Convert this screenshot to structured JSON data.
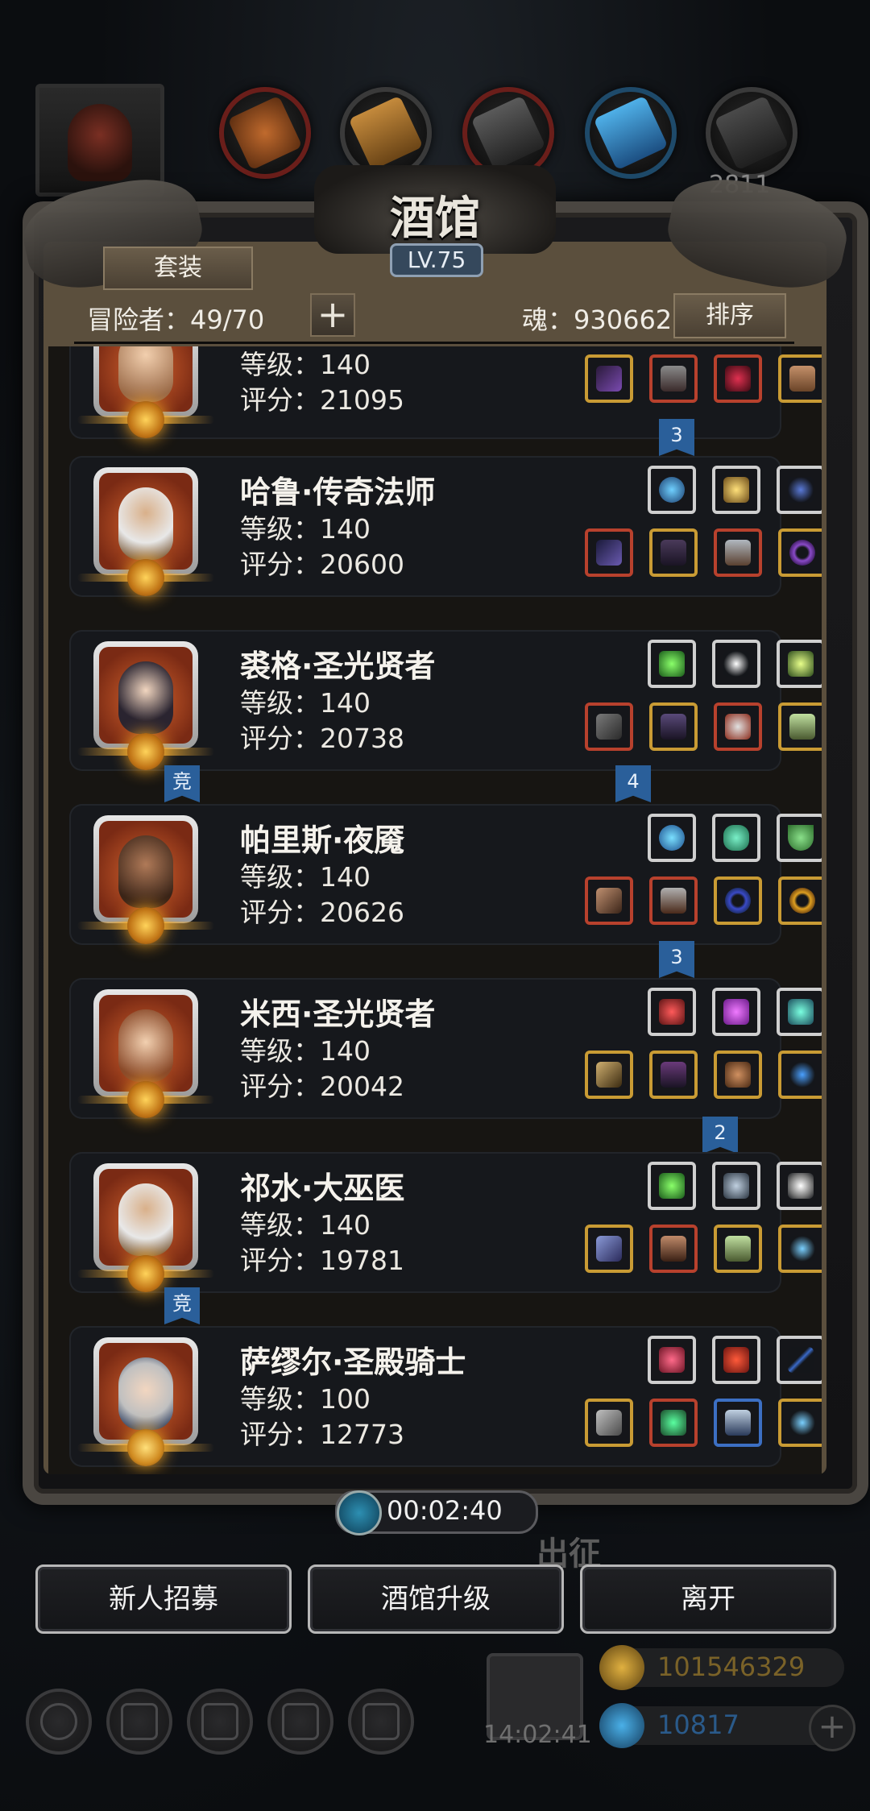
{
  "window": {
    "title": "酒馆",
    "level": "LV.75",
    "corner_number": "2811"
  },
  "toolbar": {
    "set_label": "套装",
    "adventurers_label": "冒险者：49/70",
    "add_label": "+",
    "soul_label": "魂：930662",
    "sort_label": "排序"
  },
  "heroes": [
    {
      "name": "",
      "level": "等级：140",
      "score": "评分：21095",
      "badge": "3"
    },
    {
      "name": "哈鲁·传奇法师",
      "level": "等级：140",
      "score": "评分：20600",
      "badge": ""
    },
    {
      "name": "裘格·圣光贤者",
      "level": "等级：140",
      "score": "评分：20738",
      "badge_left": "竞",
      "badge": "4"
    },
    {
      "name": "帕里斯·夜魇",
      "level": "等级：140",
      "score": "评分：20626",
      "badge": "3"
    },
    {
      "name": "米西·圣光贤者",
      "level": "等级：140",
      "score": "评分：20042",
      "badge": "2"
    },
    {
      "name": "祁水·大巫医",
      "level": "等级：140",
      "score": "评分：19781",
      "badge_left": "竞"
    },
    {
      "name": "萨缪尔·圣殿骑士",
      "level": "等级：100",
      "score": "评分：12773"
    }
  ],
  "timer": {
    "value": "00:02:40",
    "depart_label": "出征"
  },
  "buttons": {
    "recruit": "新人招募",
    "upgrade": "酒馆升级",
    "leave": "离开"
  },
  "bottom": {
    "gift_time": "14:02:41",
    "gold": "101546329",
    "gems": "10817",
    "plus": "+"
  },
  "colors": {
    "red_rarity": "#b8412d",
    "gold_rarity": "#c99b34",
    "badge_blue": "#2a5f9a",
    "panel_frame": "#4a4641"
  }
}
